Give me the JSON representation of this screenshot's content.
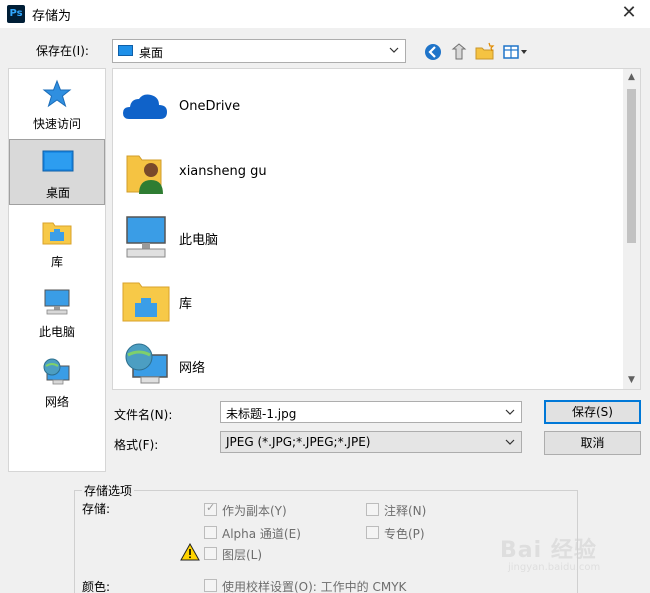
{
  "window": {
    "title": "存储为",
    "app_icon": "Ps"
  },
  "toolbar": {
    "save_in_label": "保存在(I):",
    "location": "桌面",
    "icons": [
      "back-arrow-icon",
      "up-folder-icon",
      "new-folder-icon",
      "view-menu-icon"
    ]
  },
  "places": [
    {
      "label": "快速访问",
      "icon": "star-icon"
    },
    {
      "label": "桌面",
      "icon": "desktop-icon",
      "selected": true
    },
    {
      "label": "库",
      "icon": "library-icon"
    },
    {
      "label": "此电脑",
      "icon": "computer-icon"
    },
    {
      "label": "网络",
      "icon": "network-icon"
    }
  ],
  "files": [
    {
      "label": "OneDrive",
      "icon": "onedrive-cloud-icon"
    },
    {
      "label": "xiansheng gu",
      "icon": "user-folder-icon"
    },
    {
      "label": "此电脑",
      "icon": "computer-icon"
    },
    {
      "label": "库",
      "icon": "library-icon"
    },
    {
      "label": "网络",
      "icon": "network-icon"
    }
  ],
  "form": {
    "filename_label": "文件名(N):",
    "filename_value": "未标题-1.jpg",
    "format_label": "格式(F):",
    "format_value": "JPEG (*.JPG;*.JPEG;*.JPE)"
  },
  "buttons": {
    "save": "保存(S)",
    "cancel": "取消"
  },
  "options": {
    "title": "存储选项",
    "storage_label": "存储:",
    "as_copy": "作为副本(Y)",
    "notes": "注释(N)",
    "alpha": "Alpha 通道(E)",
    "spot": "专色(P)",
    "layers": "图层(L)",
    "color_label": "颜色:",
    "proof": "使用校样设置(O): 工作中的 CMYK"
  },
  "watermark": {
    "text": "Bai 经验",
    "url": "jingyan.baidu.com"
  },
  "colors": {
    "accent": "#0078d7",
    "selection": "#d9d9d9"
  }
}
